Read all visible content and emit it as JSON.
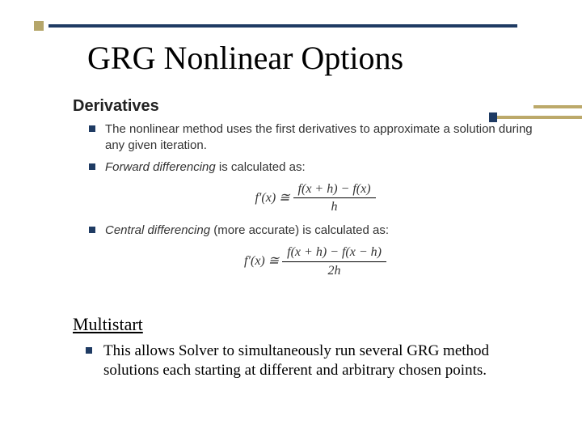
{
  "title": "GRG Nonlinear Options",
  "derivatives": {
    "heading": "Derivatives",
    "point1": "The nonlinear method uses the first derivatives to approximate a solution during any given iteration.",
    "point2_prefix": "Forward differencing",
    "point2_rest": " is calculated as:",
    "formula1_lhs": "f′(x) ≅ ",
    "formula1_num": "f(x + h) − f(x)",
    "formula1_den": "h",
    "point3_prefix": "Central differencing",
    "point3_rest": " (more accurate) is calculated as:",
    "formula2_lhs": "f′(x) ≅ ",
    "formula2_num": "f(x + h) − f(x − h)",
    "formula2_den": "2h"
  },
  "multistart": {
    "heading": "Multistart",
    "body": "This allows Solver to simultaneously run several GRG method solutions each starting at different and arbitrary chosen points."
  }
}
